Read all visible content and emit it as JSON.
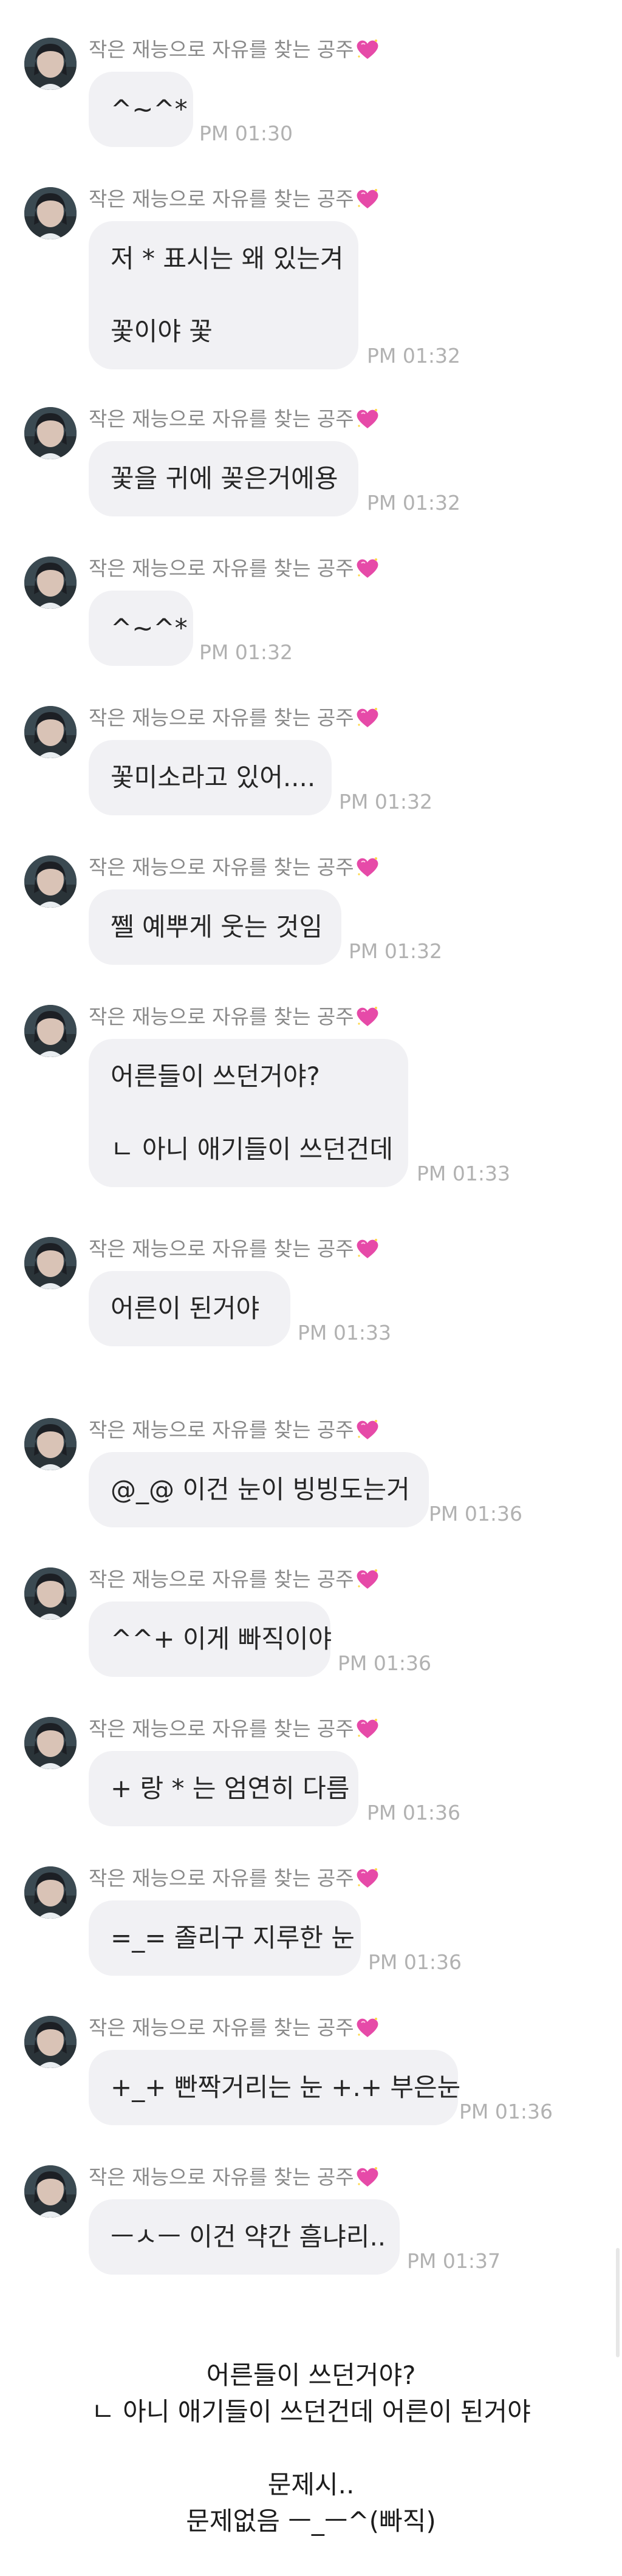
{
  "sender_name": "작은 재능으로 자유를 찾는 공주",
  "colors": {
    "bubble": "#f1f1f4",
    "sender_text": "#8a8a8a",
    "time_text": "#b1b1b1",
    "heart": "#e64aa8"
  },
  "icons": {
    "avatar": "profile-photo",
    "heart": "sparkling-heart-emoji"
  },
  "messages": [
    {
      "lines": [
        "^~^*"
      ],
      "time": "PM 01:30"
    },
    {
      "lines": [
        "저 * 표시는 왜 있는겨",
        "",
        "꽃이야 꽃"
      ],
      "time": "PM 01:32"
    },
    {
      "lines": [
        "꽃을 귀에 꽂은거에용"
      ],
      "time": "PM 01:32"
    },
    {
      "lines": [
        "^~^*"
      ],
      "time": "PM 01:32"
    },
    {
      "lines": [
        "꽃미소라고 있어...."
      ],
      "time": "PM 01:32"
    },
    {
      "lines": [
        "쩰 예뿌게 웃는 것임"
      ],
      "time": "PM 01:32"
    },
    {
      "lines": [
        "어른들이 쓰던거야?",
        "",
        "ㄴ 아니 애기들이 쓰던건데"
      ],
      "time": "PM 01:33"
    },
    {
      "lines": [
        "어른이 된거야"
      ],
      "time": "PM 01:33"
    },
    {
      "lines": [
        "@_@ 이건 눈이 빙빙도는거"
      ],
      "time": "PM 01:36"
    },
    {
      "lines": [
        "^^+ 이게 빠직이야"
      ],
      "time": "PM 01:36"
    },
    {
      "lines": [
        "+ 랑 * 는 엄연히 다름"
      ],
      "time": "PM 01:36"
    },
    {
      "lines": [
        "=_= 졸리구 지루한 눈"
      ],
      "time": "PM 01:36"
    },
    {
      "lines": [
        "+_+ 빤짝거리는 눈 +.+ 부은눈"
      ],
      "time": "PM 01:36"
    },
    {
      "lines": [
        "ㅡㅅㅡ 이건 약간 흠냐리.."
      ],
      "time": "PM 01:37"
    }
  ],
  "caption": {
    "lines": [
      "어른들이 쓰던거야?",
      "ㄴ 아니 애기들이 쓰던건데 어른이 된거야",
      "",
      "문제시..",
      "문제없음 ㅡ_ㅡ^(빠직)"
    ]
  }
}
